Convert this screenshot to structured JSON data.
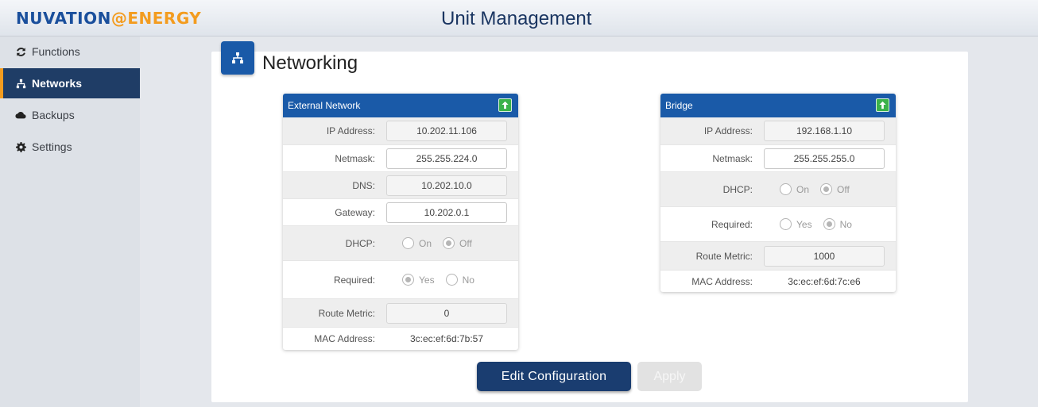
{
  "header": {
    "brand_left": "NUVATION",
    "brand_mark": "@",
    "brand_right": "ENERGY",
    "title": "Unit Management"
  },
  "sidebar": {
    "items": [
      {
        "label": "Functions",
        "icon": "refresh-icon",
        "active": false
      },
      {
        "label": "Networks",
        "icon": "network-icon",
        "active": true
      },
      {
        "label": "Backups",
        "icon": "cloud-icon",
        "active": false
      },
      {
        "label": "Settings",
        "icon": "gear-icon",
        "active": false
      }
    ]
  },
  "page": {
    "title": "Networking",
    "icon": "network-icon"
  },
  "external": {
    "title": "External Network",
    "ip_label": "IP Address:",
    "ip": "10.202.11.106",
    "netmask_label": "Netmask:",
    "netmask": "255.255.224.0",
    "dns_label": "DNS:",
    "dns": "10.202.10.0",
    "gateway_label": "Gateway:",
    "gateway": "10.202.0.1",
    "dhcp_label": "DHCP:",
    "dhcp_on": "On",
    "dhcp_off": "Off",
    "dhcp_value": "Off",
    "required_label": "Required:",
    "required_yes": "Yes",
    "required_no": "No",
    "required_value": "Yes",
    "metric_label": "Route Metric:",
    "metric": "0",
    "mac_label": "MAC Address:",
    "mac": "3c:ec:ef:6d:7b:57"
  },
  "bridge": {
    "title": "Bridge",
    "ip_label": "IP Address:",
    "ip": "192.168.1.10",
    "netmask_label": "Netmask:",
    "netmask": "255.255.255.0",
    "dhcp_label": "DHCP:",
    "dhcp_on": "On",
    "dhcp_off": "Off",
    "dhcp_value": "Off",
    "required_label": "Required:",
    "required_yes": "Yes",
    "required_no": "No",
    "required_value": "No",
    "metric_label": "Route Metric:",
    "metric": "1000",
    "mac_label": "MAC Address:",
    "mac": "3c:ec:ef:6d:7c:e6"
  },
  "actions": {
    "edit": "Edit Configuration",
    "apply": "Apply"
  },
  "colors": {
    "primary": "#1a5aa8",
    "nav_active": "#1f3d66",
    "accent": "#f39c1f",
    "upload": "#3bb24a"
  }
}
